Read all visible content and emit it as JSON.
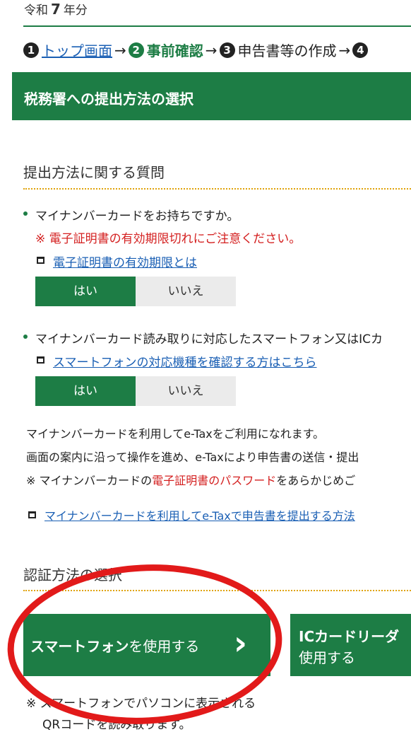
{
  "header": {
    "era": "令和",
    "year": "7",
    "suffix": "年分"
  },
  "steps": {
    "s1_num": "1",
    "s1_label": "トップ画面",
    "s2_num": "2",
    "s2_label": "事前確認",
    "s3_num": "3",
    "s3_label": "申告書等の作成",
    "s4_num": "4",
    "arrow": "→"
  },
  "banner": {
    "title": "税務署への提出方法の選択"
  },
  "questions_section": {
    "title": "提出方法に関する質問"
  },
  "q1": {
    "text": "マイナンバーカードをお持ちですか。",
    "warning": "※ 電子証明書の有効期限切れにご注意ください。",
    "link": "電子証明書の有効期限とは",
    "yes": "はい",
    "no": "いいえ"
  },
  "q2": {
    "text": "マイナンバーカード読み取りに対応したスマートフォン又はICカ",
    "link": "スマートフォンの対応機種を確認する方はこちら",
    "yes": "はい",
    "no": "いいえ"
  },
  "info": {
    "line1": "マイナンバーカードを利用してe-Taxをご利用になれます。",
    "line2": "画面の案内に沿って操作を進め、e-Taxにより申告書の送信・提出",
    "line3_pre": "※ マイナンバーカードの",
    "line3_red": "電子証明書のパスワード",
    "line3_post": "をあらかじめご",
    "link": "マイナンバーカードを利用してe-Taxで申告書を提出する方法"
  },
  "auth_section": {
    "title": "認証方法の選択"
  },
  "auth": {
    "smartphone_bold": "スマートフォン",
    "smartphone_rest": "を使用する",
    "chevron": "›",
    "ic_bold": "ICカードリーダ",
    "ic_rest": "使用する"
  },
  "footnote": {
    "line1": "※ スマートフォンでパソコンに表示される",
    "line2": "QRコードを読み取ります。"
  },
  "annotation": {
    "color": "#e21a1a"
  }
}
